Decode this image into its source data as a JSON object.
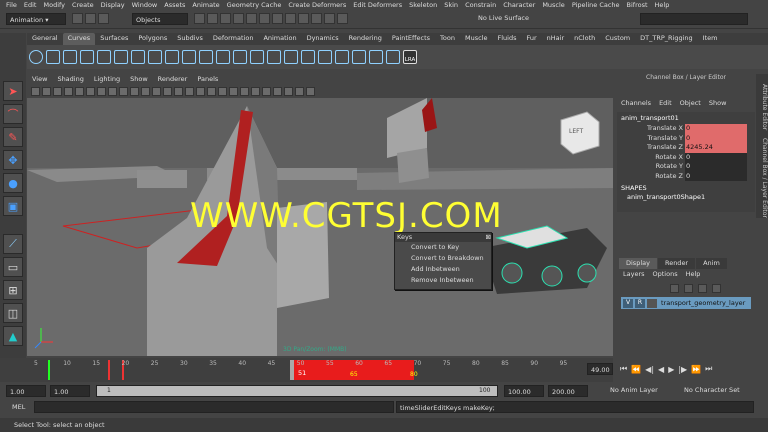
{
  "menubar": [
    "File",
    "Edit",
    "Modify",
    "Create",
    "Display",
    "Window",
    "Assets",
    "Animate",
    "Geometry Cache",
    "Create Deformers",
    "Edit Deformers",
    "Skeleton",
    "Skin",
    "Constrain",
    "Character",
    "Muscle",
    "Pipeline Cache",
    "Bifrost",
    "Help"
  ],
  "status": {
    "mode": "Animation",
    "objects_label": "Objects",
    "live_surface": "No Live Surface"
  },
  "shelf_tabs": [
    "General",
    "Curves",
    "Surfaces",
    "Polygons",
    "Subdivs",
    "Deformation",
    "Animation",
    "Dynamics",
    "Rendering",
    "PaintEffects",
    "Toon",
    "Muscle",
    "Fluids",
    "Fur",
    "nHair",
    "nCloth",
    "Custom",
    "DT_TRP_Rigging",
    "Item"
  ],
  "shelf_active": "Curves",
  "shelf_lra": "LRA",
  "viewport_menu": [
    "View",
    "Shading",
    "Lighting",
    "Show",
    "Renderer",
    "Panels"
  ],
  "viewport_cube_label": "LEFT",
  "viewport_camera_label": "3D Pan/Zoom: (MMB)",
  "watermark": "WWW.CGTSJ.COM",
  "keys_menu": {
    "title": "Keys",
    "items": [
      "Convert to Key",
      "Convert to Breakdown",
      "Add Inbetween",
      "Remove Inbetween"
    ]
  },
  "channel_box": {
    "title": "Channel Box / Layer Editor",
    "menu": [
      "Channels",
      "Edit",
      "Object",
      "Show"
    ],
    "object": "anim_transport01",
    "attrs": [
      {
        "label": "Translate X",
        "value": "0",
        "keyed": true
      },
      {
        "label": "Translate Y",
        "value": "0",
        "keyed": true
      },
      {
        "label": "Translate Z",
        "value": "4245.24",
        "keyed": true
      },
      {
        "label": "Rotate X",
        "value": "0",
        "keyed": false
      },
      {
        "label": "Rotate Y",
        "value": "0",
        "keyed": false
      },
      {
        "label": "Rotate Z",
        "value": "0",
        "keyed": false
      }
    ],
    "shapes_label": "SHAPES",
    "shape": "anim_transport0Shape1"
  },
  "side_tabs": [
    "Attribute Editor",
    "Channel Box / Layer Editor"
  ],
  "layer_tabs": [
    "Display",
    "Render",
    "Anim"
  ],
  "layer_menu": [
    "Layers",
    "Options",
    "Help"
  ],
  "layer": {
    "v": "V",
    "r": "R",
    "name": "transport_geometry_layer"
  },
  "timeline": {
    "ticks": [
      "5",
      "10",
      "15",
      "20",
      "25",
      "30",
      "35",
      "40",
      "45",
      "50",
      "55",
      "60",
      "65",
      "70",
      "75",
      "80",
      "85",
      "90",
      "95"
    ],
    "current": "51",
    "frame_field": "49.00",
    "key_labels": [
      "65",
      "80"
    ]
  },
  "range": {
    "start1": "1.00",
    "start2": "1.00",
    "slider_start": "1",
    "slider_end": "100",
    "end1": "100.00",
    "end2": "200.00",
    "anim_layer": "No Anim Layer",
    "character": "No Character Set"
  },
  "mel": {
    "label": "MEL",
    "result": "timeSliderEditKeys makeKey;"
  },
  "help_line": "Select Tool: select an object"
}
